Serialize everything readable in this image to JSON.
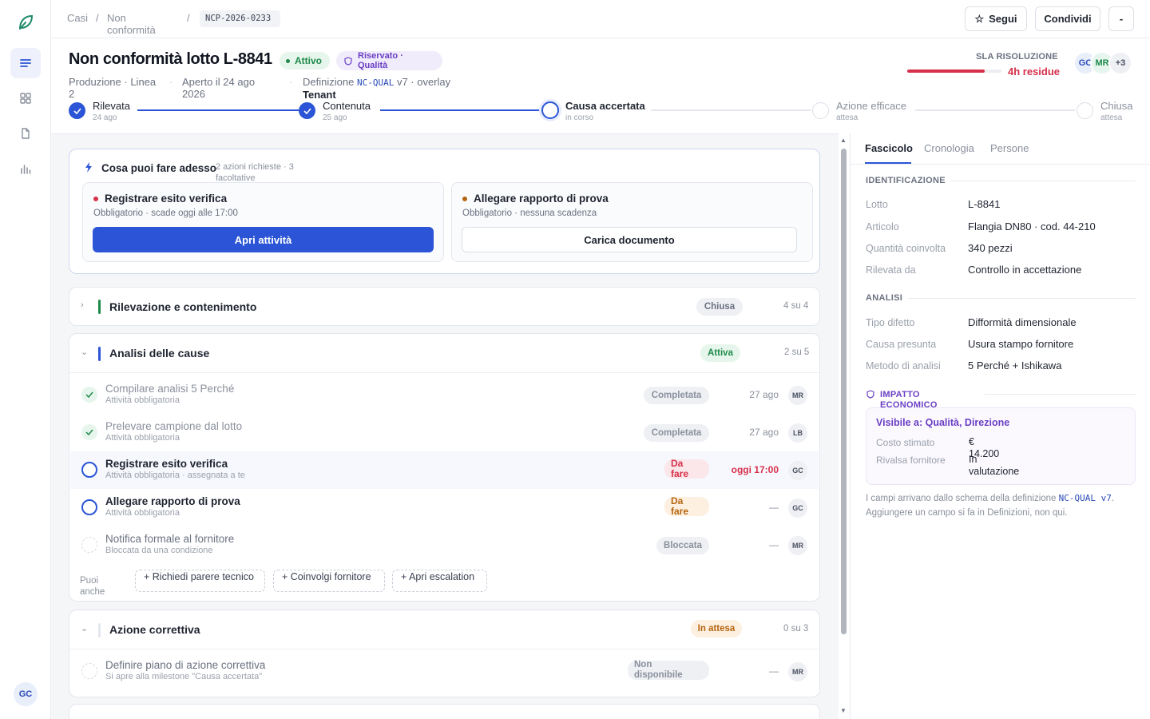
{
  "breadcrumb": {
    "items": [
      "Casi",
      "Non conformità"
    ],
    "code": "NCP-2026-0233"
  },
  "topbar": {
    "follow_label": "Segui",
    "share_label": "Condividi",
    "more_label": "-"
  },
  "case": {
    "title": "Non conformità lotto L-8841",
    "status": "Attivo",
    "restricted": "Riservato · Qualità",
    "meta_area": "Produzione · Linea 2",
    "meta_opened": "Aperto il 24 ago 2026",
    "meta_def_prefix": "Definizione",
    "meta_def_code": "NC-QUAL",
    "meta_def_suffix": "v7 · overlay",
    "meta_def_tenant": "Tenant"
  },
  "sla": {
    "label": "SLA RISOLUZIONE",
    "value": "4h residue",
    "fraction_used": 0.82,
    "color": "#d6304a"
  },
  "people": {
    "avatars": [
      "GC",
      "MR"
    ],
    "more": "+3"
  },
  "stepper": [
    {
      "label": "Rilevata",
      "sub": "24 ago",
      "state": "done"
    },
    {
      "label": "Contenuta",
      "sub": "25 ago",
      "state": "done"
    },
    {
      "label": "Causa accertata",
      "sub": "in corso",
      "state": "current"
    },
    {
      "label": "Azione efficace",
      "sub": "attesa",
      "state": "pending"
    },
    {
      "label": "Chiusa",
      "sub": "attesa",
      "state": "pending"
    }
  ],
  "next_actions": {
    "title": "Cosa puoi fare adesso",
    "summary": "2 azioni richieste · 3 facoltative",
    "items": [
      {
        "title": "Registrare esito verifica",
        "sub": "Obbligatorio · scade oggi alle 17:00",
        "button": "Apri attività"
      },
      {
        "title": "Allegare rapporto di prova",
        "sub": "Obbligatorio · nessuna scadenza",
        "button": "Carica documento"
      }
    ]
  },
  "sections": [
    {
      "title": "Rilevazione e contenimento",
      "status": "Chiusa",
      "count": "4 su 4"
    },
    {
      "title": "Analisi delle cause",
      "status": "Attiva",
      "count": "2 su 5"
    },
    {
      "title": "Azione correttiva",
      "status": "In attesa",
      "count": "0 su 3"
    }
  ],
  "analysis_rows": [
    {
      "name": "Compilare analisi 5 Perché",
      "desc": "Attività obbligatoria",
      "status": "Completata",
      "when": "27 ago",
      "who": "MR"
    },
    {
      "name": "Prelevare campione dal lotto",
      "desc": "Attività obbligatoria",
      "status": "Completata",
      "when": "27 ago",
      "who": "LB"
    },
    {
      "name": "Registrare esito verifica",
      "desc": "Attività obbligatoria · assegnata a te",
      "status": "Da fare",
      "when": "oggi 17:00",
      "who": "GC"
    },
    {
      "name": "Allegare rapporto di prova",
      "desc": "Attività obbligatoria",
      "status": "Da fare",
      "when": "—",
      "who": "GC"
    },
    {
      "name": "Notifica formale al fornitore",
      "desc": "Bloccata da una condizione",
      "status": "Bloccata",
      "when": "—",
      "who": "MR"
    }
  ],
  "also": {
    "label": "Puoi anche",
    "buttons": [
      "+ Richiedi parere tecnico",
      "+ Coinvolgi fornitore",
      "+ Apri escalation"
    ]
  },
  "corrective_rows": [
    {
      "name": "Definire piano di azione correttiva",
      "desc": "Si apre alla milestone \"Causa accertata\"",
      "status": "Non disponibile",
      "when": "—",
      "who": "MR"
    }
  ],
  "panel": {
    "tabs": [
      "Fascicolo",
      "Cronologia",
      "Persone"
    ],
    "ident_title": "IDENTIFICAZIONE",
    "ident": [
      {
        "k": "Lotto",
        "v": "L-8841"
      },
      {
        "k": "Articolo",
        "v": "Flangia DN80 · cod. 44-210"
      },
      {
        "k": "Quantità coinvolta",
        "v": "340 pezzi"
      },
      {
        "k": "Rilevata da",
        "v": "Controllo in accettazione"
      }
    ],
    "analysis_title": "ANALISI",
    "analysis": [
      {
        "k": "Tipo difetto",
        "v": "Difformità dimensionale"
      },
      {
        "k": "Causa presunta",
        "v": "Usura stampo fornitore"
      },
      {
        "k": "Metodo di analisi",
        "v": "5 Perché + Ishikawa"
      }
    ],
    "eco_title": "IMPATTO ECONOMICO",
    "eco_visible": "Visibile a: Qualità, Direzione",
    "eco": [
      {
        "k": "Costo stimato",
        "v": "€ 14.200"
      },
      {
        "k": "Rivalsa fornitore",
        "v": "In valutazione"
      }
    ],
    "note_a": "I campi arrivano dallo schema della definizione",
    "note_code": "NC-QUAL v7",
    "note_b": ". Aggiungere un campo si fa in Definizioni, non qui."
  },
  "user": {
    "initials": "GC"
  },
  "colors": {
    "primary": "#2b55d6",
    "success": "#1e8a4a",
    "danger": "#d6304a",
    "warning": "#b5650f",
    "restricted": "#6a3fc4"
  }
}
